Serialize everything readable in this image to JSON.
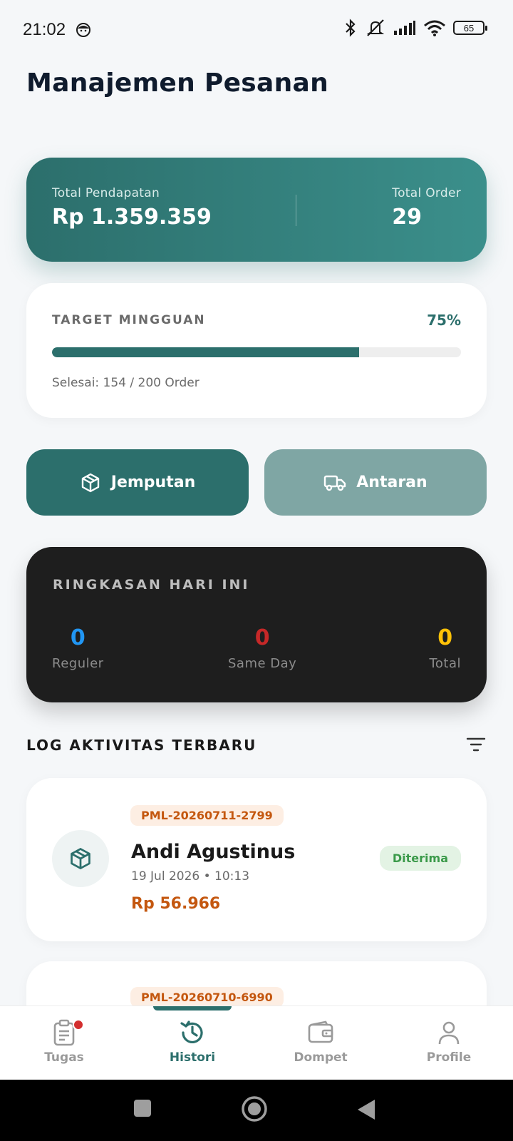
{
  "status_bar": {
    "time": "21:02",
    "battery": "65",
    "icons": [
      "face-icon",
      "bluetooth-icon",
      "mute-icon",
      "signal-icon",
      "wifi-icon",
      "battery-icon"
    ]
  },
  "page": {
    "title": "Manajemen Pesanan"
  },
  "revenue": {
    "label": "Total Pendapatan",
    "value": "Rp 1.359.359",
    "order_label": "Total Order",
    "order_value": "29"
  },
  "target": {
    "label": "TARGET MINGGUAN",
    "percent_text": "75%",
    "progress": 0.75,
    "done_text": "Selesai: 154 / 200 Order"
  },
  "actions": {
    "jemputan": "Jemputan",
    "antaran": "Antaran"
  },
  "summary": {
    "title": "RINGKASAN HARI INI",
    "items": [
      {
        "value": "0",
        "label": "Reguler",
        "color": "#2196f3"
      },
      {
        "value": "0",
        "label": "Same Day",
        "color": "#c62828"
      },
      {
        "value": "0",
        "label": "Total",
        "color": "#ffc107"
      }
    ]
  },
  "log": {
    "title": "LOG AKTIVITAS TERBARU",
    "items": [
      {
        "order_id": "PML-20260711-2799",
        "name": "Andi Agustinus",
        "date": "19 Jul 2026 • 10:13",
        "amount": "Rp 56.966",
        "status": "Diterima"
      },
      {
        "order_id": "PML-20260710-6990"
      }
    ]
  },
  "bottom_nav": {
    "items": [
      {
        "label": "Tugas",
        "icon": "clipboard-icon"
      },
      {
        "label": "Histori",
        "icon": "history-icon"
      },
      {
        "label": "Dompet",
        "icon": "wallet-icon"
      },
      {
        "label": "Profile",
        "icon": "user-icon"
      }
    ],
    "active": "Histori"
  },
  "colors": {
    "primary": "#2c6f6c",
    "accent_orange": "#c4570f",
    "dark_card": "#1e1e1e",
    "success": "#3b9a4a"
  }
}
